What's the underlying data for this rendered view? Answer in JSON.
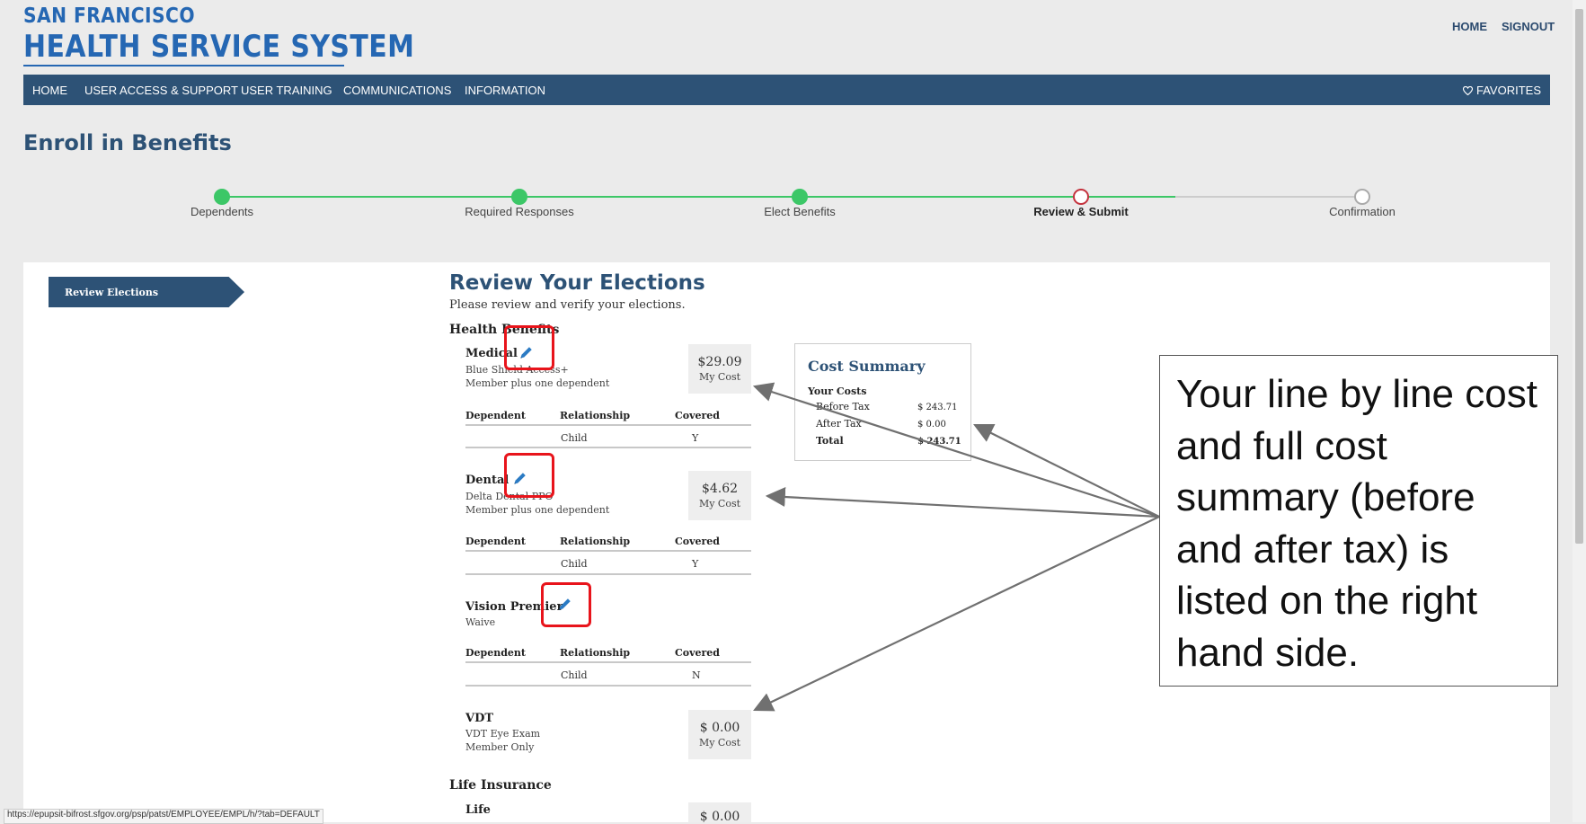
{
  "header": {
    "logo_line1": "SAN FRANCISCO",
    "logo_line2": "HEALTH SERVICE SYSTEM",
    "links": {
      "home": "HOME",
      "signout": "SIGNOUT"
    }
  },
  "nav": {
    "items": [
      "HOME",
      "USER ACCESS & SUPPORT",
      "USER TRAINING",
      "COMMUNICATIONS",
      "INFORMATION"
    ],
    "favorites": "FAVORITES",
    "favorites_icon": "heart-outline-icon"
  },
  "page_title": "Enroll in Benefits",
  "progress": {
    "steps": [
      "Dependents",
      "Required Responses",
      "Elect Benefits",
      "Review & Submit",
      "Confirmation"
    ],
    "current_step": "Review & Submit",
    "completed_color": "#3cc767",
    "current_color": "#c4323d",
    "pending_color": "#aaaaaa"
  },
  "sidebar": {
    "active_item": "Review Elections"
  },
  "review": {
    "title": "Review Your Elections",
    "subtitle": "Please review and verify your elections.",
    "health_section": "Health Benefits",
    "table_headers": {
      "dependent": "Dependent",
      "relationship": "Relationship",
      "covered": "Covered"
    },
    "plans": [
      {
        "name": "Medical",
        "plan": "Blue Shield Access+",
        "coverage": "Member plus one dependent",
        "cost": "$29.09",
        "cost_label": "My Cost",
        "dependents": [
          {
            "dependent": "",
            "relationship": "Child",
            "covered": "Y"
          }
        ]
      },
      {
        "name": "Dental",
        "plan": "Delta Dental PPO",
        "coverage": "Member plus one dependent",
        "cost": "$4.62",
        "cost_label": "My Cost",
        "dependents": [
          {
            "dependent": "",
            "relationship": "Child",
            "covered": "Y"
          }
        ]
      },
      {
        "name": "Vision Premier",
        "plan": "Waive",
        "dependents": [
          {
            "dependent": "",
            "relationship": "Child",
            "covered": "N"
          }
        ]
      },
      {
        "name": "VDT",
        "plan": "VDT Eye Exam",
        "coverage": "Member Only",
        "cost": "$ 0.00",
        "cost_label": "My Cost"
      }
    ],
    "life_section": "Life Insurance",
    "life": {
      "name": "Life",
      "cost": "$ 0.00"
    }
  },
  "cost_summary": {
    "title": "Cost Summary",
    "subtitle": "Your Costs",
    "before_tax_label": "Before Tax",
    "before_tax_value": "$ 243.71",
    "after_tax_label": "After Tax",
    "after_tax_value": "$ 0.00",
    "total_label": "Total",
    "total_value": "$ 243.71"
  },
  "callout": {
    "text": "Your line by line cost and full cost summary (before and after tax) is listed on the right hand side."
  },
  "status_url": "https://epupsit-bifrost.sfgov.org/psp/patst/EMPLOYEE/EMPL/h/?tab=DEFAULT",
  "colors": {
    "brand": "#2d5276",
    "logo": "#2567b3",
    "highlight": "#e8141b"
  }
}
